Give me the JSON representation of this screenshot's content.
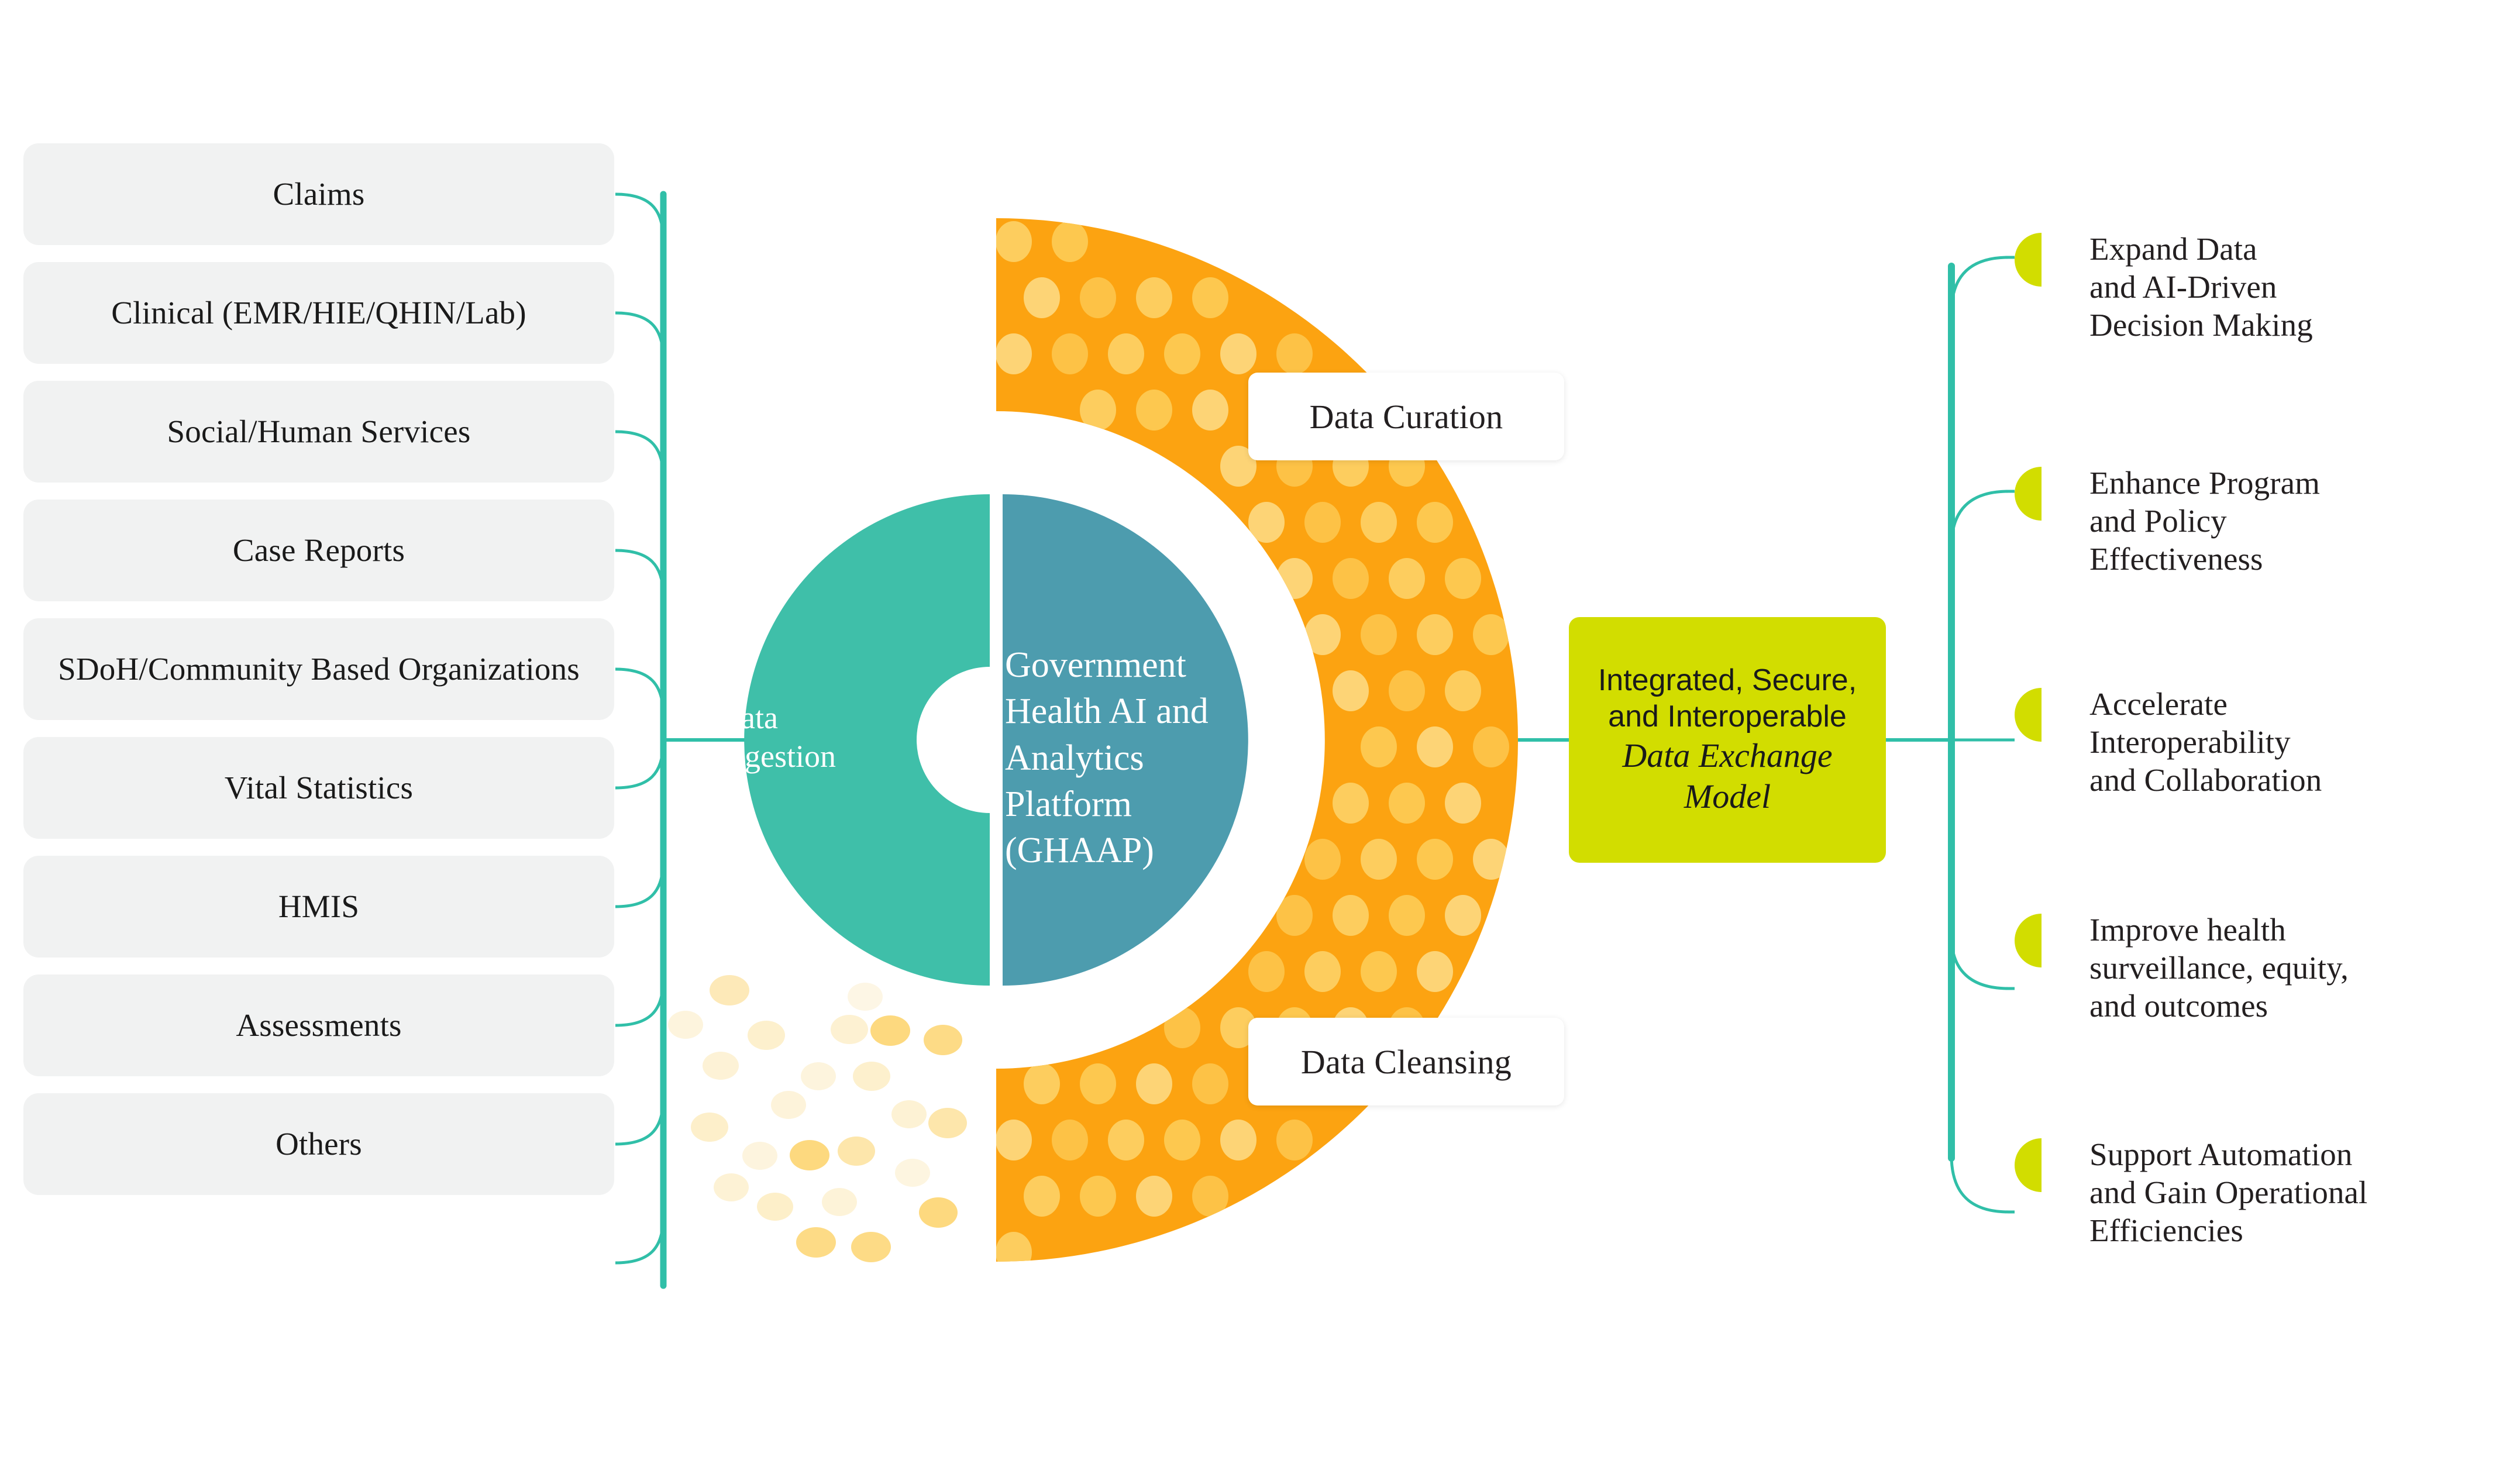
{
  "colors": {
    "teal": "#3fbfa9",
    "blue_teal": "#4d9cae",
    "orange": "#fca311",
    "orange_dot": "#fdc košice",
    "orange_dot_light": "#fdcf63",
    "lime": "#d2dd00",
    "box_gray": "#f1f2f2",
    "line_teal": "#30bfa8",
    "text_dark": "#231f20",
    "pale_yellow": "#fce9b4"
  },
  "sources": {
    "heading": "",
    "items": [
      {
        "label": "Claims"
      },
      {
        "label": "Clinical (EMR/HIE/QHIN/Lab)"
      },
      {
        "label": "Social/Human Services"
      },
      {
        "label": "Case Reports"
      },
      {
        "label": "SDoH/Community Based Organizations"
      },
      {
        "label": "Vital Statistics"
      },
      {
        "label": "HMIS"
      },
      {
        "label": "Assessments"
      },
      {
        "label": "Others"
      }
    ]
  },
  "hub": {
    "ingestion_label": "Data\nIngestion",
    "platform_label": "Government\nHealth AI and\nAnalytics\nPlatform\n(GHAAP)"
  },
  "arc_labels": {
    "curation": "Data Curation",
    "cleansing": "Data Cleansing"
  },
  "model_box": {
    "line1": "Integrated, Secure,",
    "line2": "and Interoperable",
    "line3": "Data Exchange",
    "line4": "Model"
  },
  "outcomes": {
    "items": [
      {
        "label": "Expand Data\nand AI-Driven\nDecision Making"
      },
      {
        "label": "Enhance Program\nand Policy\nEffectiveness"
      },
      {
        "label": "Accelerate\nInteroperability\nand Collaboration"
      },
      {
        "label": "Improve health\nsurveillance, equity,\nand outcomes"
      },
      {
        "label": "Support Automation\nand Gain Operational\nEfficiencies"
      }
    ]
  }
}
